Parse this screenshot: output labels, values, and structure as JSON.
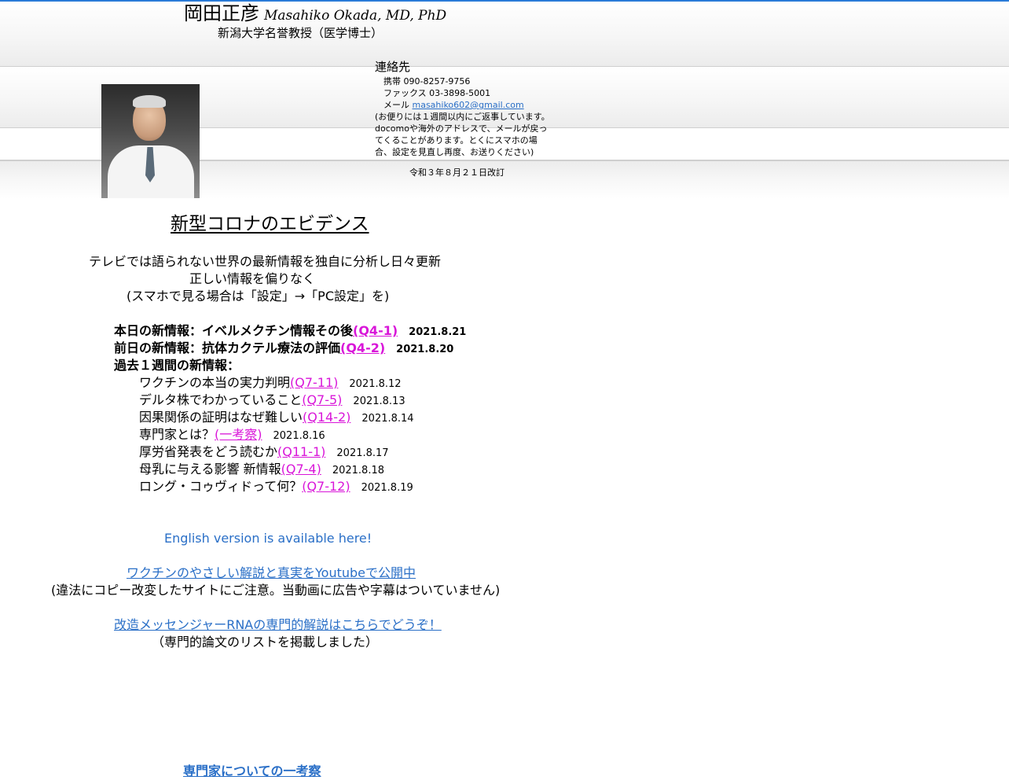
{
  "header": {
    "name_jp": "岡田正彦",
    "name_en": "Masahiko Okada, MD, PhD",
    "title_jp": "新潟大学名誉教授（医学博士）"
  },
  "contact": {
    "heading": "連絡先",
    "mobile": "携帯 090-8257-9756",
    "fax": "ファックス 03-3898-5001",
    "mail_label": "メール ",
    "mail_address": "masahiko602@gmail.com",
    "note_lines": [
      "(お便りには１週間以内にご返事しています。",
      "docomoや海外のアドレスで、メールが戻っ",
      "てくることがあります。とくにスマホの場",
      "合、設定を見直し再度、お送りください)"
    ],
    "revised": "令和３年８月２１日改訂"
  },
  "main": {
    "title": "新型コロナのエビデンス",
    "intro": [
      "テレビでは語られない世界の最新情報を独自に分析し日々更新",
      "正しい情報を偏りなく",
      "(スマホで見る場合は「設定」→「PC設定」を)"
    ],
    "today": {
      "label": "本日の新情報：イベルメクチン情報その後",
      "link": "(Q4-1)",
      "date": "2021.8.21"
    },
    "yesterday": {
      "label": "前日の新情報：抗体カクテル療法の評価",
      "link": "(Q4-2)",
      "date": "2021.8.20"
    },
    "week_heading": "過去１週間の新情報：",
    "week_items": [
      {
        "text": "ワクチンの本当の実力判明",
        "link": "(Q7-11)",
        "date": "2021.8.12"
      },
      {
        "text": "デルタ株でわかっていること",
        "link": "(Q7-5)",
        "date": "2021.8.13"
      },
      {
        "text": "因果関係の証明はなぜ難しい",
        "link": "(Q14-2)",
        "date": "2021.8.14"
      },
      {
        "text": "専門家とは？",
        "link": "(一考察)",
        "date": "2021.8.16"
      },
      {
        "text": "厚労省発表をどう読むか",
        "link": "(Q11-1)",
        "date": "2021.8.17"
      },
      {
        "text": "母乳に与える影響 新情報",
        "link": "(Q7-4)",
        "date": "2021.8.18"
      },
      {
        "text": "ロング・コゥヴィドって何？",
        "link": "(Q7-12)",
        "date": "2021.8.19"
      }
    ],
    "english_link": "English version is available here!",
    "youtube_link": "ワクチンのやさしい解説と真実をYoutubeで公開中",
    "youtube_note": "(違法にコピー改変したサイトにご注意。当動画に広告や字幕はついていません)",
    "mrna_link": "改造メッセンジャーRNAの専門的解説はこちらでどうぞ！",
    "mrna_note": "（専門的論文のリストを掲載しました）",
    "expert_link": "専門家についての一考察"
  },
  "colors": {
    "accent_link": "#2a6fc7",
    "q_link": "#d916d9",
    "top_line": "#2a7bd8"
  }
}
